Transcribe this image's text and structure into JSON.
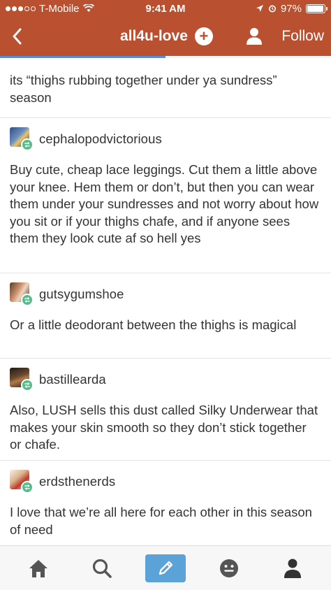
{
  "status_bar": {
    "carrier": "T-Mobile",
    "time": "9:41 AM",
    "battery": "97%",
    "battery_level": 0.97
  },
  "nav": {
    "title": "all4u-love",
    "follow_label": "Follow",
    "scroll_progress": 0.5
  },
  "posts": [
    {
      "username": "",
      "body": "its “thighs rubbing together under ya sundress” season"
    },
    {
      "username": "cephalopodvictorious",
      "body": "Buy cute, cheap lace leggings. Cut them a little above your knee. Hem them or don’t, but then you can wear them under your sundresses and not worry about how you sit or if your thighs chafe, and if anyone sees them they look cute af so hell yes"
    },
    {
      "username": "gutsygumshoe",
      "body": "Or a little deodorant between the thighs is magical"
    },
    {
      "username": "bastillearda",
      "body": "Also, LUSH sells this dust called Silky Underwear that makes your skin smooth so they don’t stick together or chafe."
    },
    {
      "username": "erdsthenerds",
      "body": "I love that we’re all here for each other in this season of need"
    }
  ],
  "tabbar": {
    "items": [
      "home-icon",
      "search-icon",
      "compose-icon",
      "activity-icon",
      "account-icon"
    ]
  },
  "colors": {
    "header": "#b9502f",
    "reblog": "#56bc8a",
    "compose": "#5aa2d8"
  }
}
